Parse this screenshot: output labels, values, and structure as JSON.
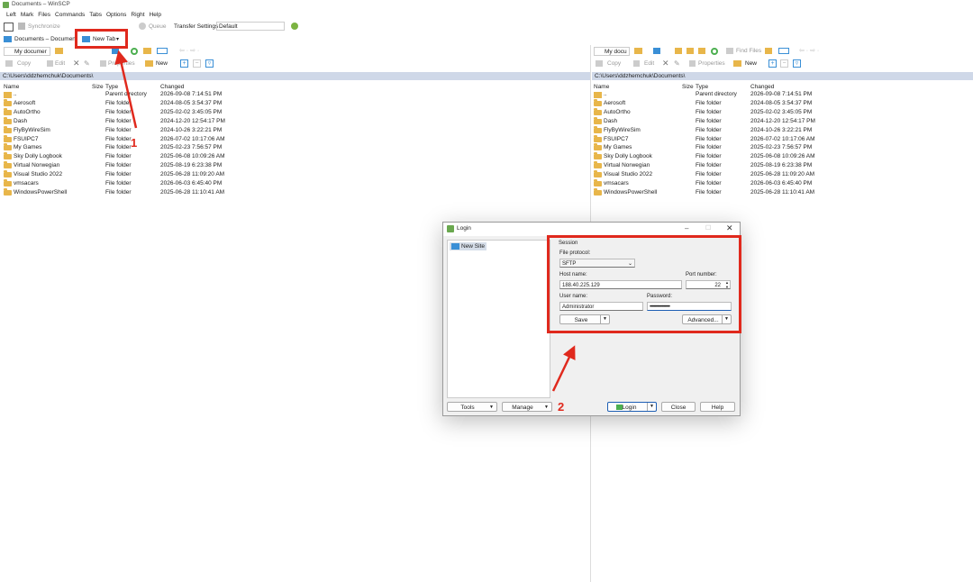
{
  "window": {
    "title": "Documents – WinSCP"
  },
  "menu": [
    "Left",
    "Mark",
    "Files",
    "Commands",
    "Tabs",
    "Options",
    "Right",
    "Help"
  ],
  "toolbar": {
    "synchronize": "Synchronize",
    "queue": "Queue",
    "transfer_settings_label": "Transfer Settings",
    "transfer_settings_value": "Default"
  },
  "tabs": {
    "documents": "Documents – Document",
    "new_tab": "New Tab"
  },
  "left_panel": {
    "location": "My documer",
    "actions": {
      "copy": "Copy",
      "edit": "Edit",
      "properties": "Properties",
      "new": "New"
    },
    "path": "C:\\Users\\ddzhemchuk\\Documents\\"
  },
  "right_panel": {
    "location": "My docu",
    "find_files": "Find Files",
    "actions": {
      "copy": "Copy",
      "edit": "Edit",
      "properties": "Properties",
      "new": "New"
    },
    "path": "C:\\Users\\ddzhemchuk\\Documents\\"
  },
  "columns": {
    "name": "Name",
    "size": "Size",
    "type": "Type",
    "changed": "Changed"
  },
  "files": [
    {
      "name": "..",
      "type": "Parent directory",
      "changed": "2026-09-08 7:14:51 PM",
      "parent": true
    },
    {
      "name": "Aerosoft",
      "type": "File folder",
      "changed": "2024-08-05 3:54:37 PM"
    },
    {
      "name": "AutoOrtho",
      "type": "File folder",
      "changed": "2025-02-02 3:45:05 PM"
    },
    {
      "name": "Dash",
      "type": "File folder",
      "changed": "2024-12-20 12:54:17 PM"
    },
    {
      "name": "FlyByWireSim",
      "type": "File folder",
      "changed": "2024-10-26 3:22:21 PM"
    },
    {
      "name": "FSUIPC7",
      "type": "File folder",
      "changed": "2026-07-02 10:17:06 AM"
    },
    {
      "name": "My Games",
      "type": "File folder",
      "changed": "2025-02-23 7:56:57 PM"
    },
    {
      "name": "Sky Dolly Logbook",
      "type": "File folder",
      "changed": "2025-06-08 10:09:26 AM"
    },
    {
      "name": "Virtual Norwegian",
      "type": "File folder",
      "changed": "2025-08-19 6:23:38 PM"
    },
    {
      "name": "Visual Studio 2022",
      "type": "File folder",
      "changed": "2025-06-28 11:09:20 AM"
    },
    {
      "name": "vmsacars",
      "type": "File folder",
      "changed": "2026-06-03 6:45:40 PM"
    },
    {
      "name": "WindowsPowerShell",
      "type": "File folder",
      "changed": "2025-06-28 11:10:41 AM"
    }
  ],
  "login": {
    "title": "Login",
    "site": "New Site",
    "session": "Session",
    "file_protocol_label": "File protocol:",
    "file_protocol_value": "SFTP",
    "host_label": "Host name:",
    "host_value": "188.40.225.129",
    "port_label": "Port number:",
    "port_value": "22",
    "user_label": "User name:",
    "user_value": "Administrator",
    "password_label": "Password:",
    "password_value": "••••••••••••••••••••",
    "save": "Save",
    "advanced": "Advanced...",
    "tools": "Tools",
    "manage": "Manage",
    "login_btn": "Login",
    "close": "Close",
    "help": "Help"
  },
  "annotations": {
    "step1": "1",
    "step2": "2",
    "color": "#e0291d"
  }
}
